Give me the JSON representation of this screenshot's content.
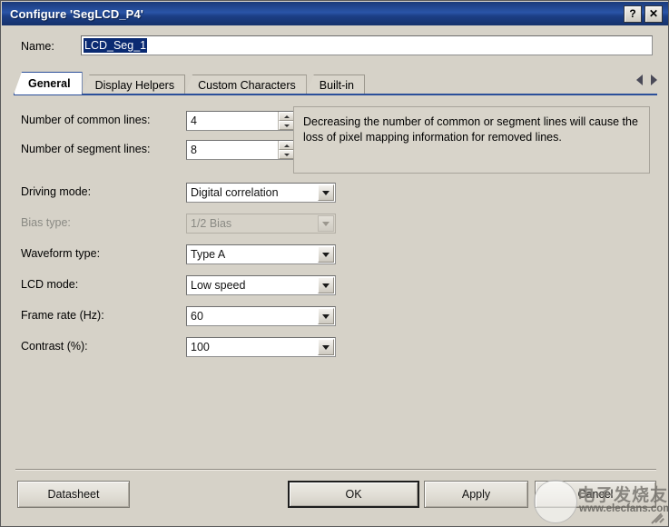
{
  "window": {
    "title": "Configure 'SegLCD_P4'",
    "help_button": "?",
    "close_button": "✕"
  },
  "name_field": {
    "label": "Name:",
    "value": "LCD_Seg_1"
  },
  "tabs": [
    {
      "label": "General",
      "active": true
    },
    {
      "label": "Display Helpers",
      "active": false
    },
    {
      "label": "Custom Characters",
      "active": false
    },
    {
      "label": "Built-in",
      "active": false
    }
  ],
  "tab_nav": {
    "prev": "prev-tab",
    "next": "next-tab"
  },
  "general": {
    "common_lines": {
      "label": "Number of common lines:",
      "value": "4"
    },
    "segment_lines": {
      "label": "Number of segment lines:",
      "value": "8"
    },
    "driving_mode": {
      "label": "Driving mode:",
      "value": "Digital correlation",
      "disabled": false
    },
    "bias_type": {
      "label": "Bias type:",
      "value": "1/2 Bias",
      "disabled": true
    },
    "waveform_type": {
      "label": "Waveform type:",
      "value": "Type A",
      "disabled": false
    },
    "lcd_mode": {
      "label": "LCD mode:",
      "value": "Low speed",
      "disabled": false
    },
    "frame_rate": {
      "label": "Frame rate (Hz):",
      "value": "60",
      "disabled": false
    },
    "contrast": {
      "label": "Contrast (%):",
      "value": "100",
      "disabled": false
    },
    "info_text": "Decreasing the number of common or segment lines will cause the loss of pixel mapping information for removed lines."
  },
  "footer": {
    "datasheet": "Datasheet",
    "ok": "OK",
    "apply": "Apply",
    "cancel": "Cancel"
  },
  "watermark": {
    "cn_text": "电子发烧友",
    "url": "www.elecfans.com"
  },
  "colors": {
    "title_bar": "#1c3f86",
    "dialog_bg": "#d6d2c8",
    "tab_accent": "#2b4f9a",
    "selection": "#0a2a72"
  }
}
